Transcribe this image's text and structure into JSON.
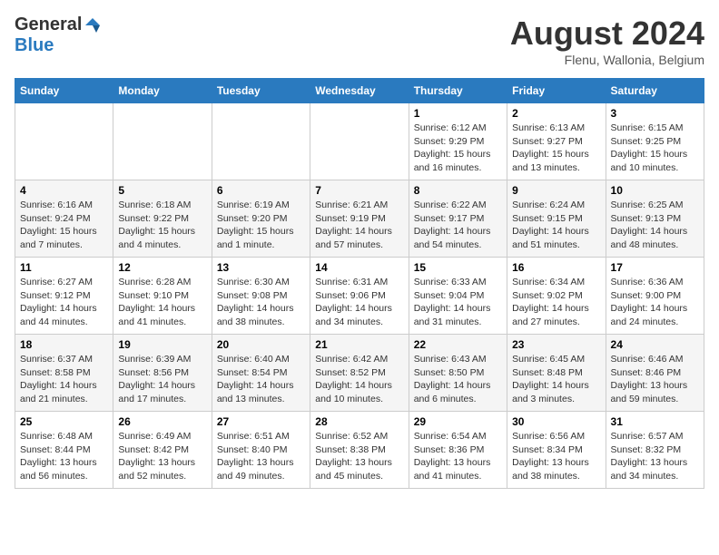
{
  "header": {
    "logo": {
      "general": "General",
      "blue": "Blue"
    },
    "title": "August 2024",
    "location": "Flenu, Wallonia, Belgium"
  },
  "calendar": {
    "weekdays": [
      "Sunday",
      "Monday",
      "Tuesday",
      "Wednesday",
      "Thursday",
      "Friday",
      "Saturday"
    ],
    "weeks": [
      [
        {
          "day": "",
          "sunrise": "",
          "sunset": "",
          "daylight": ""
        },
        {
          "day": "",
          "sunrise": "",
          "sunset": "",
          "daylight": ""
        },
        {
          "day": "",
          "sunrise": "",
          "sunset": "",
          "daylight": ""
        },
        {
          "day": "",
          "sunrise": "",
          "sunset": "",
          "daylight": ""
        },
        {
          "day": "1",
          "sunrise": "Sunrise: 6:12 AM",
          "sunset": "Sunset: 9:29 PM",
          "daylight": "Daylight: 15 hours and 16 minutes."
        },
        {
          "day": "2",
          "sunrise": "Sunrise: 6:13 AM",
          "sunset": "Sunset: 9:27 PM",
          "daylight": "Daylight: 15 hours and 13 minutes."
        },
        {
          "day": "3",
          "sunrise": "Sunrise: 6:15 AM",
          "sunset": "Sunset: 9:25 PM",
          "daylight": "Daylight: 15 hours and 10 minutes."
        }
      ],
      [
        {
          "day": "4",
          "sunrise": "Sunrise: 6:16 AM",
          "sunset": "Sunset: 9:24 PM",
          "daylight": "Daylight: 15 hours and 7 minutes."
        },
        {
          "day": "5",
          "sunrise": "Sunrise: 6:18 AM",
          "sunset": "Sunset: 9:22 PM",
          "daylight": "Daylight: 15 hours and 4 minutes."
        },
        {
          "day": "6",
          "sunrise": "Sunrise: 6:19 AM",
          "sunset": "Sunset: 9:20 PM",
          "daylight": "Daylight: 15 hours and 1 minute."
        },
        {
          "day": "7",
          "sunrise": "Sunrise: 6:21 AM",
          "sunset": "Sunset: 9:19 PM",
          "daylight": "Daylight: 14 hours and 57 minutes."
        },
        {
          "day": "8",
          "sunrise": "Sunrise: 6:22 AM",
          "sunset": "Sunset: 9:17 PM",
          "daylight": "Daylight: 14 hours and 54 minutes."
        },
        {
          "day": "9",
          "sunrise": "Sunrise: 6:24 AM",
          "sunset": "Sunset: 9:15 PM",
          "daylight": "Daylight: 14 hours and 51 minutes."
        },
        {
          "day": "10",
          "sunrise": "Sunrise: 6:25 AM",
          "sunset": "Sunset: 9:13 PM",
          "daylight": "Daylight: 14 hours and 48 minutes."
        }
      ],
      [
        {
          "day": "11",
          "sunrise": "Sunrise: 6:27 AM",
          "sunset": "Sunset: 9:12 PM",
          "daylight": "Daylight: 14 hours and 44 minutes."
        },
        {
          "day": "12",
          "sunrise": "Sunrise: 6:28 AM",
          "sunset": "Sunset: 9:10 PM",
          "daylight": "Daylight: 14 hours and 41 minutes."
        },
        {
          "day": "13",
          "sunrise": "Sunrise: 6:30 AM",
          "sunset": "Sunset: 9:08 PM",
          "daylight": "Daylight: 14 hours and 38 minutes."
        },
        {
          "day": "14",
          "sunrise": "Sunrise: 6:31 AM",
          "sunset": "Sunset: 9:06 PM",
          "daylight": "Daylight: 14 hours and 34 minutes."
        },
        {
          "day": "15",
          "sunrise": "Sunrise: 6:33 AM",
          "sunset": "Sunset: 9:04 PM",
          "daylight": "Daylight: 14 hours and 31 minutes."
        },
        {
          "day": "16",
          "sunrise": "Sunrise: 6:34 AM",
          "sunset": "Sunset: 9:02 PM",
          "daylight": "Daylight: 14 hours and 27 minutes."
        },
        {
          "day": "17",
          "sunrise": "Sunrise: 6:36 AM",
          "sunset": "Sunset: 9:00 PM",
          "daylight": "Daylight: 14 hours and 24 minutes."
        }
      ],
      [
        {
          "day": "18",
          "sunrise": "Sunrise: 6:37 AM",
          "sunset": "Sunset: 8:58 PM",
          "daylight": "Daylight: 14 hours and 21 minutes."
        },
        {
          "day": "19",
          "sunrise": "Sunrise: 6:39 AM",
          "sunset": "Sunset: 8:56 PM",
          "daylight": "Daylight: 14 hours and 17 minutes."
        },
        {
          "day": "20",
          "sunrise": "Sunrise: 6:40 AM",
          "sunset": "Sunset: 8:54 PM",
          "daylight": "Daylight: 14 hours and 13 minutes."
        },
        {
          "day": "21",
          "sunrise": "Sunrise: 6:42 AM",
          "sunset": "Sunset: 8:52 PM",
          "daylight": "Daylight: 14 hours and 10 minutes."
        },
        {
          "day": "22",
          "sunrise": "Sunrise: 6:43 AM",
          "sunset": "Sunset: 8:50 PM",
          "daylight": "Daylight: 14 hours and 6 minutes."
        },
        {
          "day": "23",
          "sunrise": "Sunrise: 6:45 AM",
          "sunset": "Sunset: 8:48 PM",
          "daylight": "Daylight: 14 hours and 3 minutes."
        },
        {
          "day": "24",
          "sunrise": "Sunrise: 6:46 AM",
          "sunset": "Sunset: 8:46 PM",
          "daylight": "Daylight: 13 hours and 59 minutes."
        }
      ],
      [
        {
          "day": "25",
          "sunrise": "Sunrise: 6:48 AM",
          "sunset": "Sunset: 8:44 PM",
          "daylight": "Daylight: 13 hours and 56 minutes."
        },
        {
          "day": "26",
          "sunrise": "Sunrise: 6:49 AM",
          "sunset": "Sunset: 8:42 PM",
          "daylight": "Daylight: 13 hours and 52 minutes."
        },
        {
          "day": "27",
          "sunrise": "Sunrise: 6:51 AM",
          "sunset": "Sunset: 8:40 PM",
          "daylight": "Daylight: 13 hours and 49 minutes."
        },
        {
          "day": "28",
          "sunrise": "Sunrise: 6:52 AM",
          "sunset": "Sunset: 8:38 PM",
          "daylight": "Daylight: 13 hours and 45 minutes."
        },
        {
          "day": "29",
          "sunrise": "Sunrise: 6:54 AM",
          "sunset": "Sunset: 8:36 PM",
          "daylight": "Daylight: 13 hours and 41 minutes."
        },
        {
          "day": "30",
          "sunrise": "Sunrise: 6:56 AM",
          "sunset": "Sunset: 8:34 PM",
          "daylight": "Daylight: 13 hours and 38 minutes."
        },
        {
          "day": "31",
          "sunrise": "Sunrise: 6:57 AM",
          "sunset": "Sunset: 8:32 PM",
          "daylight": "Daylight: 13 hours and 34 minutes."
        }
      ]
    ]
  }
}
